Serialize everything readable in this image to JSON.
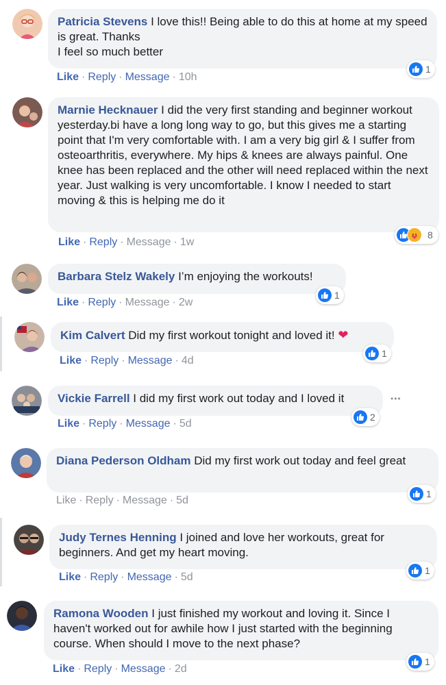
{
  "comments": [
    {
      "author": "Patricia Stevens",
      "text": " I love this!! Being able to do this at home at my speed is great. Thanks\nI feel so much better",
      "like": "Like",
      "reply": "Reply",
      "message": "Message",
      "time": "10h",
      "reaction_count": "1",
      "avatar_color": "#f7c8a8"
    },
    {
      "author": "Marnie Hecknauer",
      "text": " I did the very first standing and beginner workout yesterday.bi have a long long way to go, but this gives me a starting point that I'm very comfortable with. I am a very big girl & I suffer from osteoarthritis, everywhere. My hips & knees are always painful. One knee has been replaced and the other will need replaced within the next year. Just walking is very uncomfortable. I know I needed to start moving & this is helping me do it",
      "like": "Like",
      "reply": "Reply",
      "message": "Message",
      "time": "1w",
      "reaction_count": "8",
      "avatar_color": "#8a5a4a"
    },
    {
      "author": "Barbara Stelz Wakely",
      "text": " I’m enjoying the workouts!",
      "like": "Like",
      "reply": "Reply",
      "message": "Message",
      "time": "2w",
      "reaction_count": "1",
      "avatar_color": "#a08a7a"
    },
    {
      "author": "Kim Calvert",
      "text": " Did my first workout tonight and loved it! ",
      "heart": "❤",
      "like": "Like",
      "reply": "Reply",
      "message": "Message",
      "time": "4d",
      "reaction_count": "1",
      "avatar_color": "#c79a86"
    },
    {
      "author": "Vickie Farrell",
      "text": " I did my first work out today and I loved it",
      "like": "Like",
      "reply": "Reply",
      "message": "Message",
      "time": "5d",
      "reaction_count": "2",
      "avatar_color": "#9aa0a8",
      "more": "•••"
    },
    {
      "author": "Diana Pederson Oldham",
      "text": " Did my first work out today and feel great",
      "like": "Like",
      "reply": "Reply",
      "message": "Message",
      "time": "5d",
      "reaction_count": "1",
      "avatar_color": "#b07a6a"
    },
    {
      "author": "Judy Ternes Henning",
      "text": " I joined and love her workouts, great for beginners. And get my heart moving.",
      "like": "Like",
      "reply": "Reply",
      "message": "Message",
      "time": "5d",
      "reaction_count": "1",
      "avatar_color": "#6a5a50"
    },
    {
      "author": "Ramona Wooden",
      "text": " I just finished my workout and loving it. Since I haven't worked out for awhile how I just started with the beginning course. When should I move to the next phase?",
      "like": "Like",
      "reply": "Reply",
      "message": "Message",
      "time": "2d",
      "reaction_count": "1",
      "avatar_color": "#3a3a4a"
    }
  ],
  "colors": {
    "link": "#385898",
    "action": "#4267b2",
    "muted": "#90949c",
    "bubble": "#f2f3f5",
    "like_blue": "#1877f2"
  }
}
